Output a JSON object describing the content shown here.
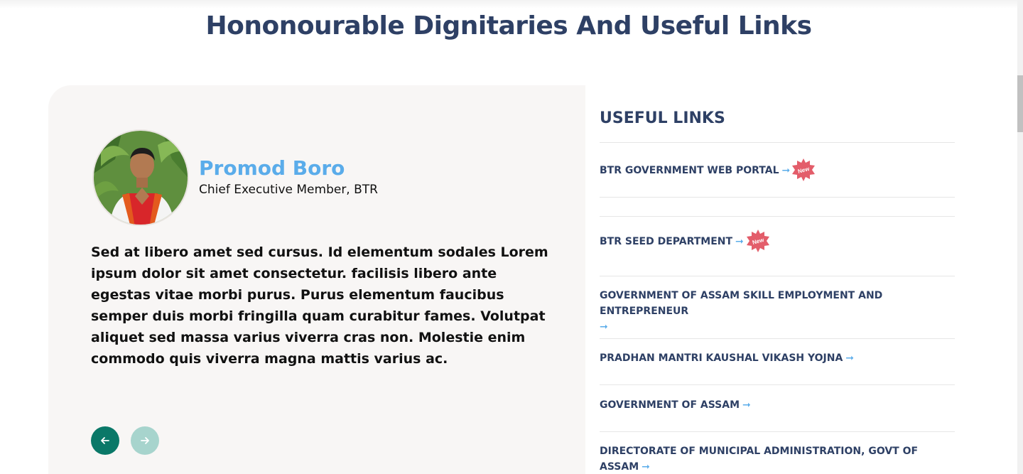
{
  "section": {
    "title": "Hononourable Dignitaries And Useful Links"
  },
  "dignitary": {
    "name": "Promod Boro",
    "role": "Chief Executive Member, BTR",
    "quote": "Sed at libero amet sed cursus. Id elementum sodales Lorem ipsum dolor sit amet consectetur. facilisis libero ante egestas vitae morbi purus. Purus elementum faucibus semper duis morbi fringilla quam curabitur fames. Volutpat aliquet sed massa varius viverra cras non. Molestie enim commodo quis viverra magna mattis varius ac."
  },
  "carousel": {
    "prev_icon": "arrow-left-icon",
    "next_icon": "arrow-right-icon"
  },
  "useful_links": {
    "title": "USEFUL LINKS",
    "arrow": "➞",
    "badge_label": "New",
    "items": [
      {
        "label": "BTR GOVERNMENT WEB PORTAL",
        "is_new": true
      },
      {
        "label": "BTR SEED DEPARTMENT",
        "is_new": true
      },
      {
        "label": "GOVERNMENT OF ASSAM SKILL EMPLOYMENT AND ENTREPRENEUR",
        "is_new": false
      },
      {
        "label": "PRADHAN MANTRI KAUSHAL VIKASH YOJNA",
        "is_new": false
      },
      {
        "label": "GOVERNMENT OF ASSAM",
        "is_new": false
      },
      {
        "label": "DIRECTORATE OF MUNICIPAL ADMINISTRATION, GOVT OF ASSAM",
        "is_new": false
      }
    ]
  },
  "colors": {
    "heading": "#2e4065",
    "name_accent": "#5aacea",
    "nav_active": "#0a7868",
    "nav_inactive": "#a7d4cd",
    "badge": "#e35d6a",
    "card_bg": "#f8f6f5"
  }
}
